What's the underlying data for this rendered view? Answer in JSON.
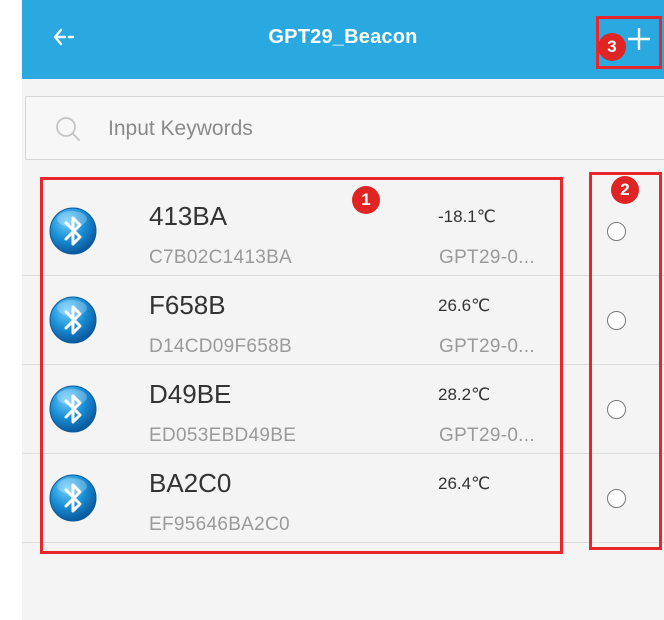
{
  "header": {
    "title": "GPT29_Beacon"
  },
  "search": {
    "placeholder": "Input Keywords"
  },
  "devices": [
    {
      "name": "413BA",
      "mac": "C7B02C1413BA",
      "temp": "-18.1℃",
      "model": "GPT29-0..."
    },
    {
      "name": "F658B",
      "mac": "D14CD09F658B",
      "temp": "26.6℃",
      "model": "GPT29-0..."
    },
    {
      "name": "D49BE",
      "mac": "ED053EBD49BE",
      "temp": "28.2℃",
      "model": "GPT29-0..."
    },
    {
      "name": "BA2C0",
      "mac": "EF95646BA2C0",
      "temp": "26.4℃",
      "model": ""
    }
  ],
  "annotations": {
    "list_label": "1",
    "select_label": "2",
    "add_label": "3"
  },
  "colors": {
    "header": "#2aa8e0",
    "annotation": "#e8262c",
    "bluetooth": "#1a8fd6"
  },
  "icons": {
    "back": "back-arrow-icon",
    "add": "plus-icon",
    "search": "search-icon",
    "device": "bluetooth-icon"
  }
}
